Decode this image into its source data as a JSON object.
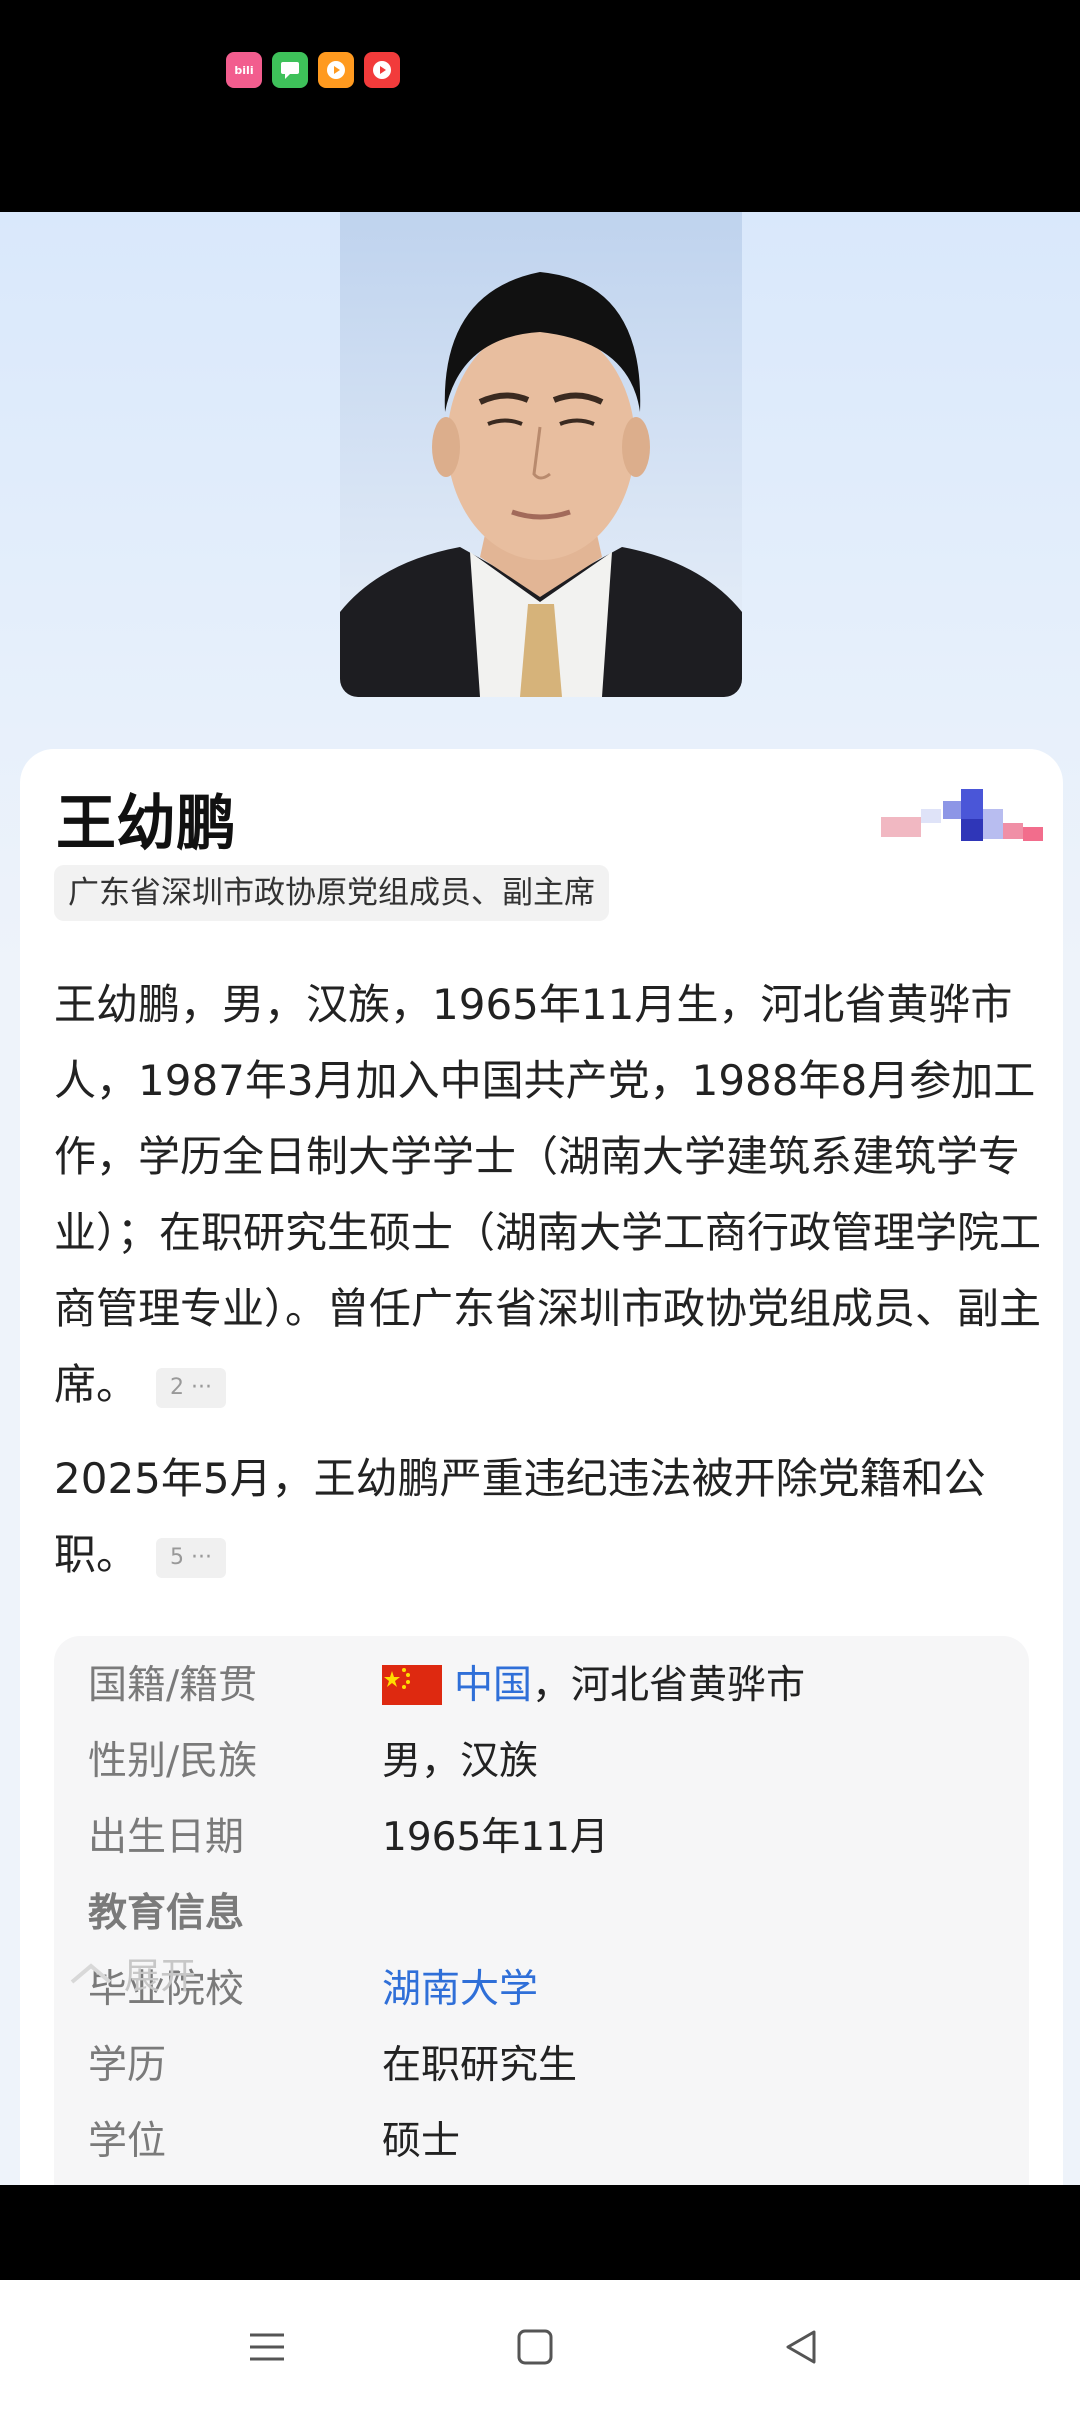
{
  "status_icons": [
    {
      "name": "bilibili-icon",
      "text": "bili"
    },
    {
      "name": "messages-icon",
      "text": ""
    },
    {
      "name": "video-icon",
      "text": ""
    },
    {
      "name": "red-video-icon",
      "text": ""
    }
  ],
  "profile": {
    "name": "王幼鹏",
    "title": "广东省深圳市政协原党组成员、副主席",
    "paragraph_1": "王幼鹏，男，汉族，1965年11月生，河北省黄骅市人，1987年3月加入中国共产党，1988年8月参加工作，学历全日制大学学士（湖南大学建筑系建筑学专业）；在职研究生硕士（湖南大学工商行政管理学院工商管理专业）。曾任广东省深圳市政协党组成员、副主席。",
    "ref_1": "2 ···",
    "paragraph_2": "2025年5月，王幼鹏严重违纪违法被开除党籍和公职。",
    "ref_2": "5 ···"
  },
  "info": {
    "nationality_label": "国籍/籍贯",
    "nationality_link": "中国",
    "nationality_rest": "，河北省黄骅市",
    "gender_label": "性别/民族",
    "gender_value": "男，汉族",
    "birth_label": "出生日期",
    "birth_value": "1965年11月",
    "education_header": "教育信息",
    "school_label": "毕业院校",
    "school_value": "湖南大学",
    "edu_label": "学历",
    "edu_value": "在职研究生",
    "degree_label": "学位",
    "degree_value": "硕士"
  },
  "expand_label": "展开",
  "colors": {
    "link": "#2f6fd8",
    "flag_red": "#de2910",
    "flag_yellow": "#ffde00"
  }
}
